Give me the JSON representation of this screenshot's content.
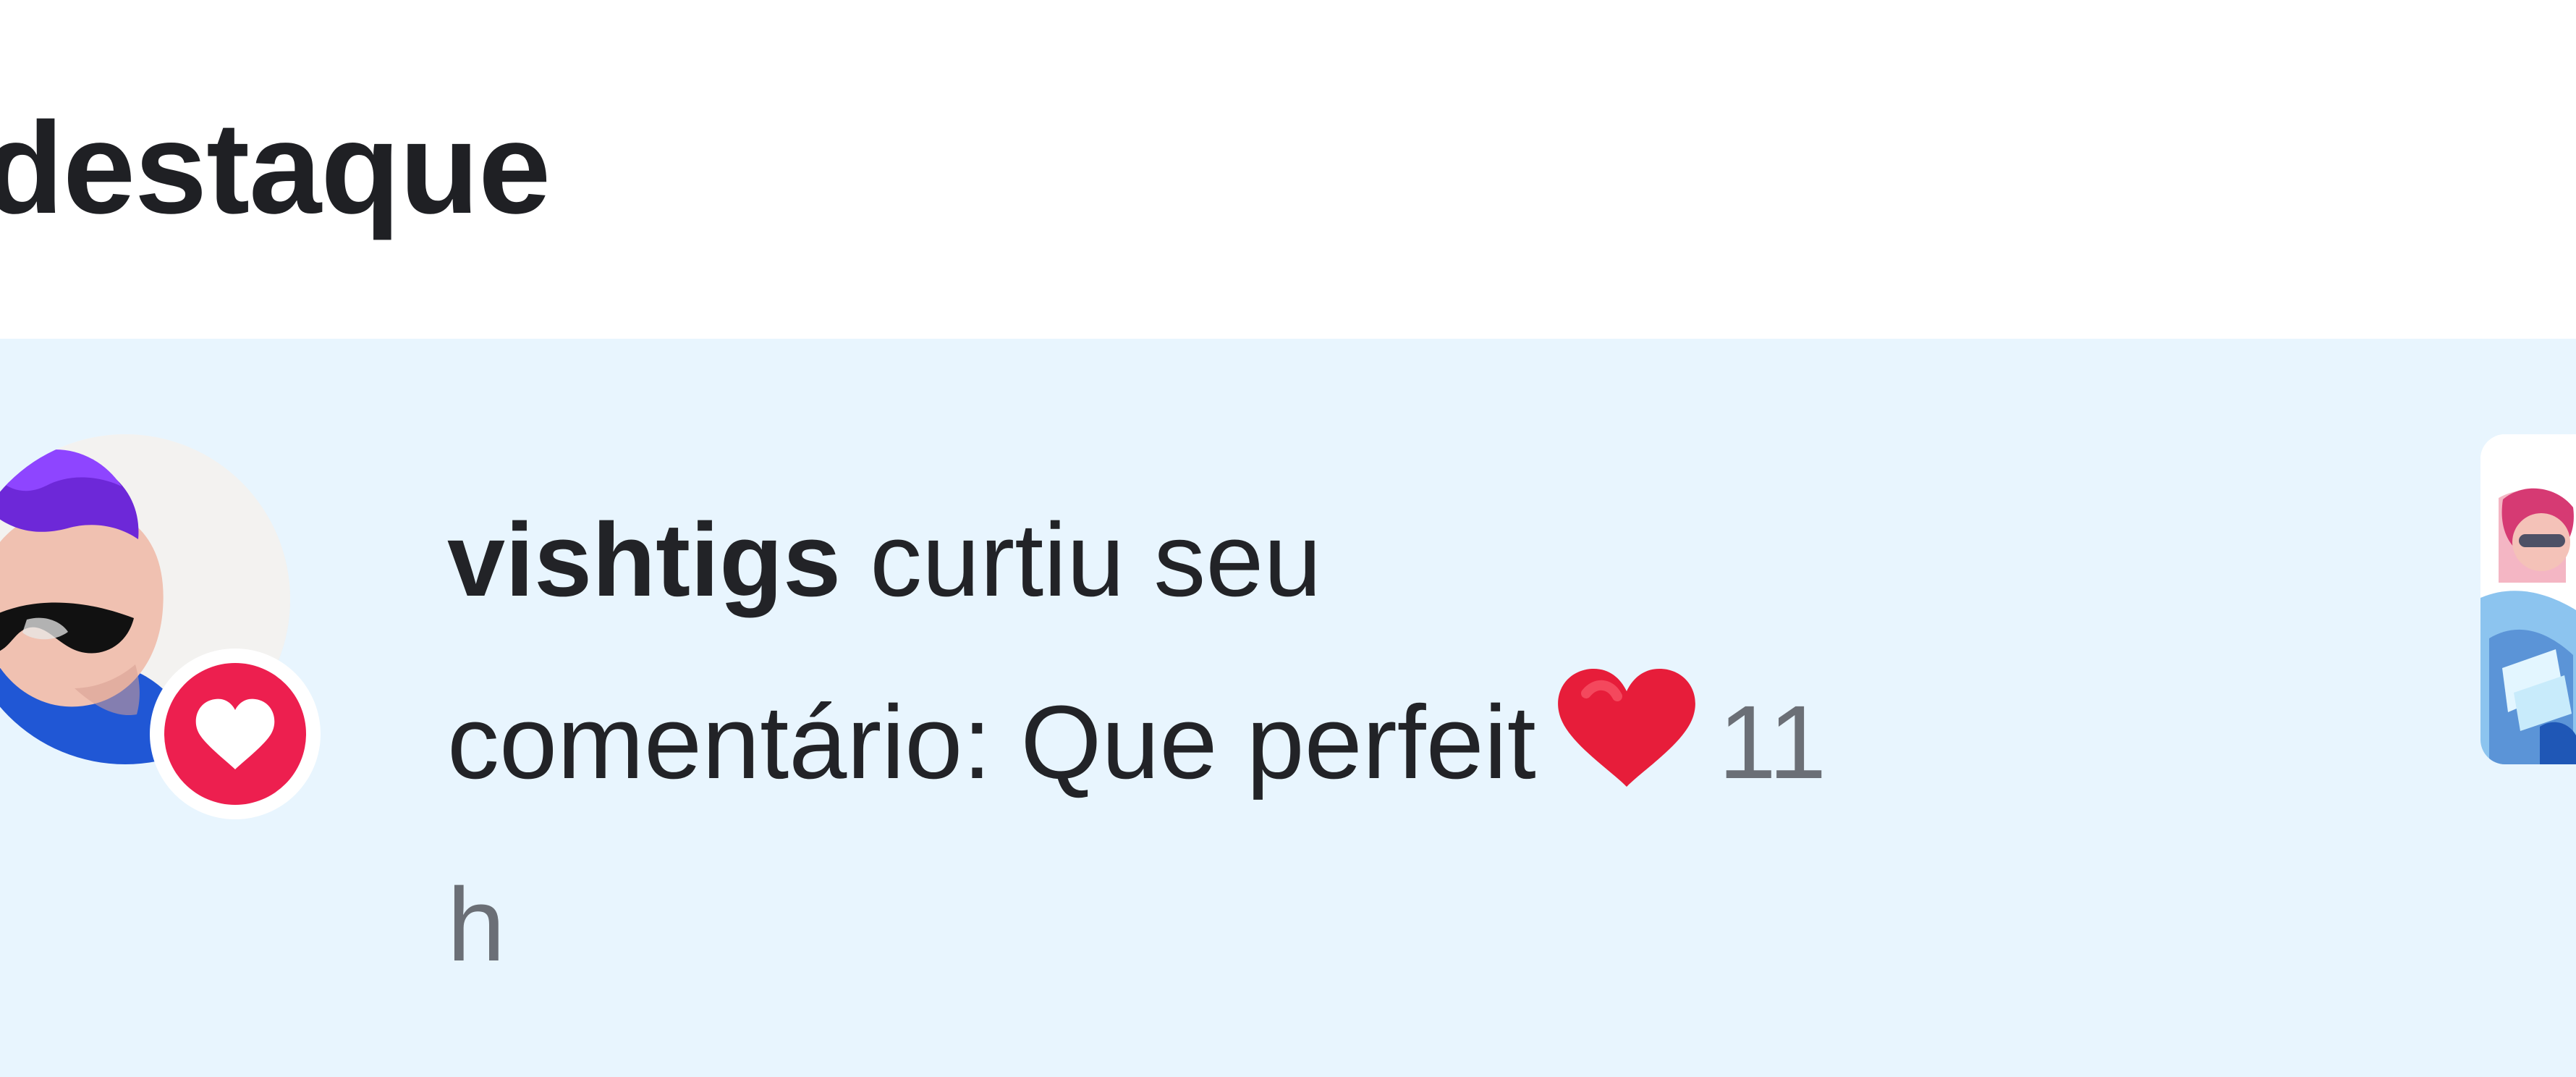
{
  "section": {
    "title": "destaque"
  },
  "notification": {
    "username": "vishtigs",
    "action": "curtiu seu",
    "comment": "comentário: Que perfeit",
    "emoji": "red-heart-emoji",
    "time_number": "11",
    "time_unit": "h",
    "badge_icon": "heart-icon"
  },
  "colors": {
    "background": "#ffffff",
    "notification_background": "#e8f5fe",
    "primary_text": "#222327",
    "secondary_text": "#6b6f76",
    "like_badge": "#ed1f4f",
    "emoji_heart": "#e71d3a"
  }
}
